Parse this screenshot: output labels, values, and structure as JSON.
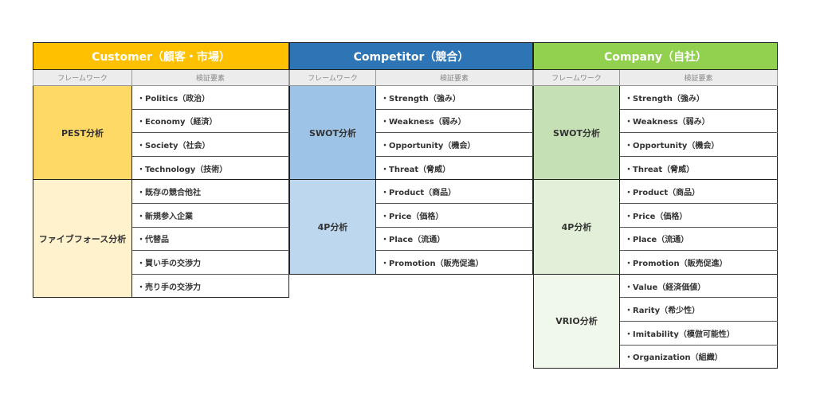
{
  "columns": [
    {
      "id": "customer",
      "title": "Customer（顧客・市場）",
      "header_color": "#FFC000",
      "sub_headers": {
        "framework": "フレームワーク",
        "elements": "検証要素"
      },
      "frameworks": [
        {
          "name": "PEST分析",
          "color": "#FFD966",
          "elements": [
            "・Politics（政治）",
            "・Economy（経済）",
            "・Society（社会）",
            "・Technology（技術）"
          ]
        },
        {
          "name": "ファイブフォース分析",
          "color": "#FFF2CC",
          "elements": [
            "・既存の競合他社",
            "・新規参入企業",
            "・代替品",
            "・買い手の交渉力",
            "・売り手の交渉力"
          ]
        }
      ]
    },
    {
      "id": "competitor",
      "title": "Competitor（競合）",
      "header_color": "#2E75B6",
      "sub_headers": {
        "framework": "フレームワーク",
        "elements": "検証要素"
      },
      "frameworks": [
        {
          "name": "SWOT分析",
          "color": "#9DC3E6",
          "elements": [
            "・Strength（強み）",
            "・Weakness（弱み）",
            "・Opportunity（機会）",
            "・Threat（脅威）"
          ]
        },
        {
          "name": "4P分析",
          "color": "#BDD7EE",
          "elements": [
            "・Product（商品）",
            "・Price（価格）",
            "・Place（流通）",
            "・Promotion（販売促進）"
          ]
        }
      ]
    },
    {
      "id": "company",
      "title": "Company（自社）",
      "header_color": "#92D050",
      "sub_headers": {
        "framework": "フレームワーク",
        "elements": "検証要素"
      },
      "frameworks": [
        {
          "name": "SWOT分析",
          "color": "#C5E0B4",
          "elements": [
            "・Strength（強み）",
            "・Weakness（弱み）",
            "・Opportunity（機会）",
            "・Threat（脅威）"
          ]
        },
        {
          "name": "4P分析",
          "color": "#E2F0D9",
          "elements": [
            "・Product（商品）",
            "・Price（価格）",
            "・Place（流通）",
            "・Promotion（販売促進）"
          ]
        },
        {
          "name": "VRIO分析",
          "color": "#F0F7EB",
          "elements": [
            "・Value（経済価値）",
            "・Rarity（希少性）",
            "・Imitability（模倣可能性）",
            "・Organization（組織）"
          ]
        }
      ]
    }
  ]
}
